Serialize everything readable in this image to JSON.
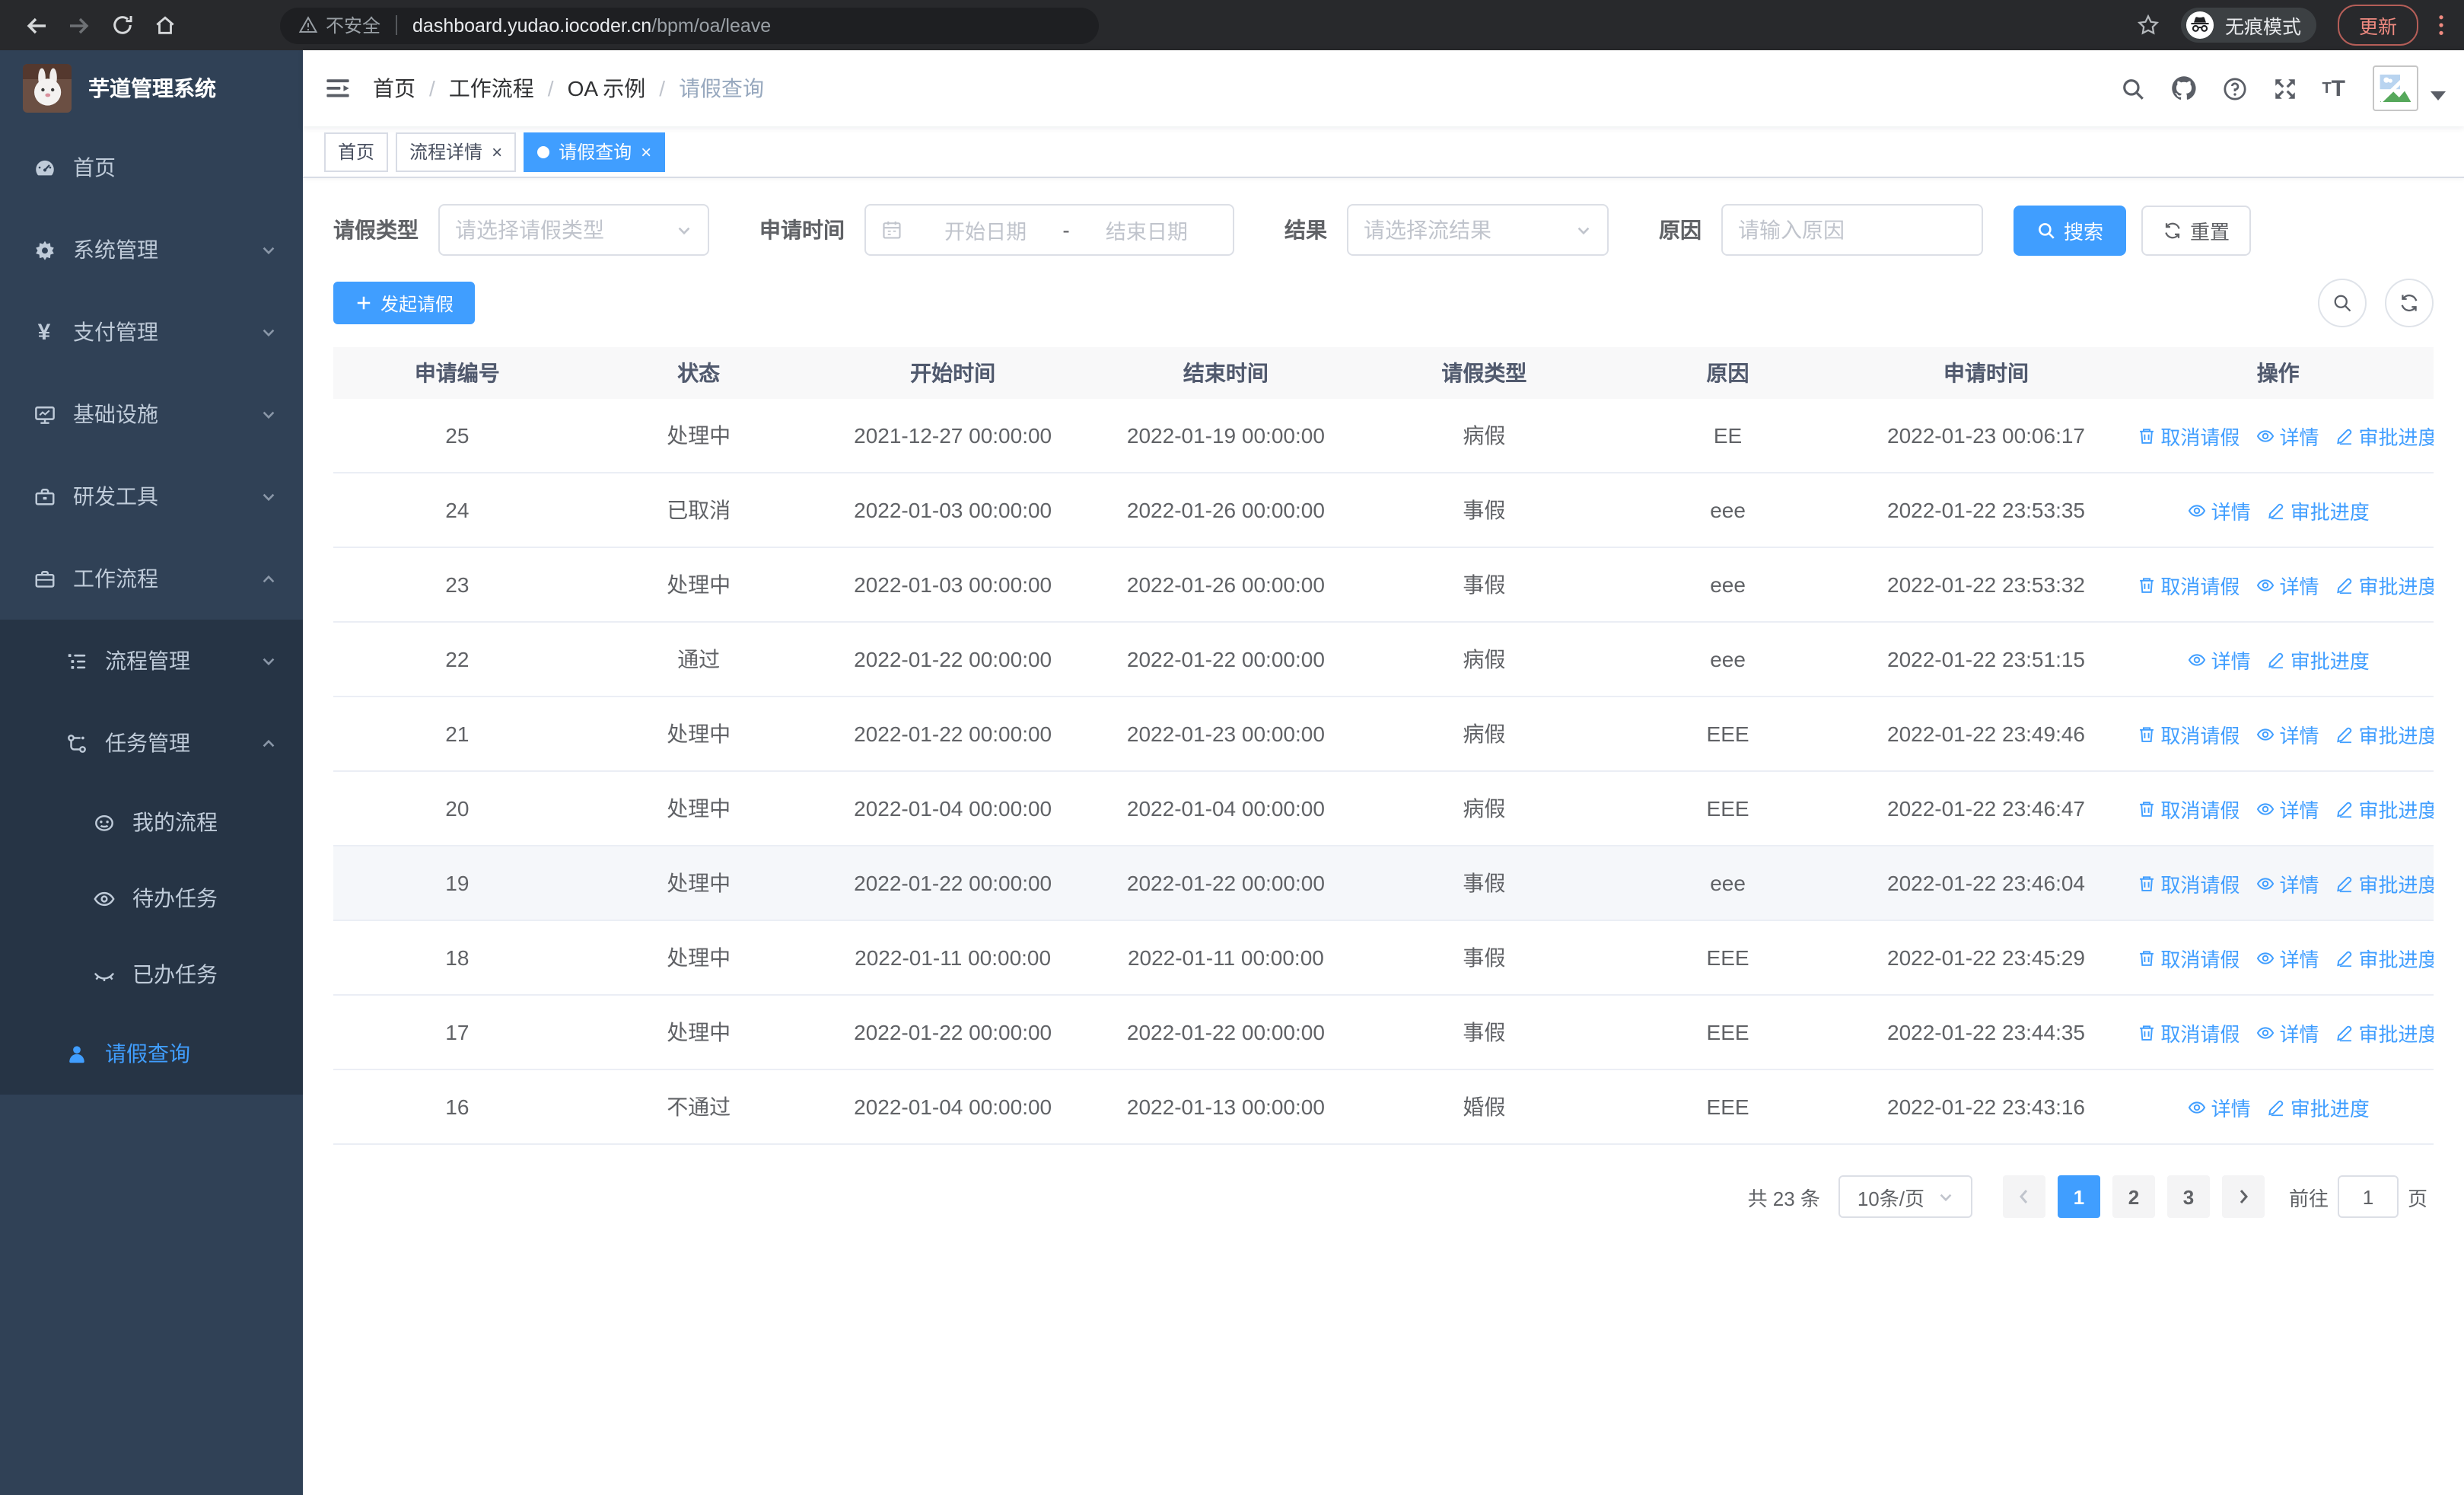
{
  "browser": {
    "security_label": "不安全",
    "url_domain": "dashboard.yudao.iocoder.cn",
    "url_path": "/bpm/oa/leave",
    "incognito_label": "无痕模式",
    "update_label": "更新"
  },
  "sidebar": {
    "title": "芋道管理系统",
    "items": [
      {
        "key": "home",
        "label": "首页",
        "icon": "dashboard",
        "level": 1
      },
      {
        "key": "system",
        "label": "系统管理",
        "icon": "gear",
        "level": 1,
        "chevron": "down"
      },
      {
        "key": "payment",
        "label": "支付管理",
        "icon": "yen",
        "level": 1,
        "chevron": "down"
      },
      {
        "key": "infra",
        "label": "基础设施",
        "icon": "monitor",
        "level": 1,
        "chevron": "down"
      },
      {
        "key": "devtools",
        "label": "研发工具",
        "icon": "toolbox",
        "level": 1,
        "chevron": "down"
      },
      {
        "key": "workflow",
        "label": "工作流程",
        "icon": "briefcase",
        "level": 1,
        "chevron": "up"
      },
      {
        "key": "process-mgmt",
        "label": "流程管理",
        "icon": "listicon",
        "level": 2,
        "chevron": "down",
        "nested": true
      },
      {
        "key": "task-mgmt",
        "label": "任务管理",
        "icon": "flow",
        "level": 2,
        "chevron": "up",
        "nested": true
      },
      {
        "key": "my-process",
        "label": "我的流程",
        "icon": "face",
        "level": 3,
        "nested": true
      },
      {
        "key": "todo-tasks",
        "label": "待办任务",
        "icon": "eye",
        "level": 3,
        "nested": true
      },
      {
        "key": "done-tasks",
        "label": "已办任务",
        "icon": "eyeclosed",
        "level": 3,
        "nested": true
      },
      {
        "key": "leave-query",
        "label": "请假查询",
        "icon": "user",
        "level": 2,
        "nested": true,
        "active": true
      }
    ]
  },
  "navbar": {
    "breadcrumb": [
      "首页",
      "工作流程",
      "OA 示例",
      "请假查询"
    ]
  },
  "tabs": [
    {
      "key": "home",
      "label": "首页",
      "closable": false,
      "active": false
    },
    {
      "key": "process-detail",
      "label": "流程详情",
      "closable": true,
      "active": false
    },
    {
      "key": "leave-query",
      "label": "请假查询",
      "closable": true,
      "active": true
    }
  ],
  "filters": {
    "leave_type_label": "请假类型",
    "leave_type_placeholder": "请选择请假类型",
    "apply_time_label": "申请时间",
    "date_start_placeholder": "开始日期",
    "date_separator": "-",
    "date_end_placeholder": "结束日期",
    "result_label": "结果",
    "result_placeholder": "请选择流结果",
    "reason_label": "原因",
    "reason_placeholder": "请输入原因",
    "search_label": "搜索",
    "reset_label": "重置"
  },
  "toolbar": {
    "create_label": "发起请假"
  },
  "table": {
    "columns": [
      "申请编号",
      "状态",
      "开始时间",
      "结束时间",
      "请假类型",
      "原因",
      "申请时间",
      "操作"
    ],
    "action_labels": {
      "cancel": "取消请假",
      "detail": "详情",
      "progress": "审批进度"
    },
    "rows": [
      {
        "id": "25",
        "status": "处理中",
        "start": "2021-12-27 00:00:00",
        "end": "2022-01-19 00:00:00",
        "type": "病假",
        "reason": "EE",
        "apply_time": "2022-01-23 00:06:17",
        "actions": [
          "cancel",
          "detail",
          "progress"
        ],
        "highlighted": false
      },
      {
        "id": "24",
        "status": "已取消",
        "start": "2022-01-03 00:00:00",
        "end": "2022-01-26 00:00:00",
        "type": "事假",
        "reason": "eee",
        "apply_time": "2022-01-22 23:53:35",
        "actions": [
          "detail",
          "progress"
        ],
        "highlighted": false
      },
      {
        "id": "23",
        "status": "处理中",
        "start": "2022-01-03 00:00:00",
        "end": "2022-01-26 00:00:00",
        "type": "事假",
        "reason": "eee",
        "apply_time": "2022-01-22 23:53:32",
        "actions": [
          "cancel",
          "detail",
          "progress"
        ],
        "highlighted": false
      },
      {
        "id": "22",
        "status": "通过",
        "start": "2022-01-22 00:00:00",
        "end": "2022-01-22 00:00:00",
        "type": "病假",
        "reason": "eee",
        "apply_time": "2022-01-22 23:51:15",
        "actions": [
          "detail",
          "progress"
        ],
        "highlighted": false
      },
      {
        "id": "21",
        "status": "处理中",
        "start": "2022-01-22 00:00:00",
        "end": "2022-01-23 00:00:00",
        "type": "病假",
        "reason": "EEE",
        "apply_time": "2022-01-22 23:49:46",
        "actions": [
          "cancel",
          "detail",
          "progress"
        ],
        "highlighted": false
      },
      {
        "id": "20",
        "status": "处理中",
        "start": "2022-01-04 00:00:00",
        "end": "2022-01-04 00:00:00",
        "type": "病假",
        "reason": "EEE",
        "apply_time": "2022-01-22 23:46:47",
        "actions": [
          "cancel",
          "detail",
          "progress"
        ],
        "highlighted": false
      },
      {
        "id": "19",
        "status": "处理中",
        "start": "2022-01-22 00:00:00",
        "end": "2022-01-22 00:00:00",
        "type": "事假",
        "reason": "eee",
        "apply_time": "2022-01-22 23:46:04",
        "actions": [
          "cancel",
          "detail",
          "progress"
        ],
        "highlighted": true
      },
      {
        "id": "18",
        "status": "处理中",
        "start": "2022-01-11 00:00:00",
        "end": "2022-01-11 00:00:00",
        "type": "事假",
        "reason": "EEE",
        "apply_time": "2022-01-22 23:45:29",
        "actions": [
          "cancel",
          "detail",
          "progress"
        ],
        "highlighted": false
      },
      {
        "id": "17",
        "status": "处理中",
        "start": "2022-01-22 00:00:00",
        "end": "2022-01-22 00:00:00",
        "type": "事假",
        "reason": "EEE",
        "apply_time": "2022-01-22 23:44:35",
        "actions": [
          "cancel",
          "detail",
          "progress"
        ],
        "highlighted": false
      },
      {
        "id": "16",
        "status": "不通过",
        "start": "2022-01-04 00:00:00",
        "end": "2022-01-13 00:00:00",
        "type": "婚假",
        "reason": "EEE",
        "apply_time": "2022-01-22 23:43:16",
        "actions": [
          "detail",
          "progress"
        ],
        "highlighted": false
      }
    ]
  },
  "pagination": {
    "total_label": "共 23 条",
    "page_size": "10条/页",
    "pages": [
      "1",
      "2",
      "3"
    ],
    "active_page": "1",
    "goto_label": "前往",
    "goto_value": "1",
    "page_unit": "页"
  },
  "colors": {
    "accent": "#409eff",
    "sidebar_bg": "#304156",
    "sidebar_submenu_bg": "#263445",
    "update_accent": "#ef8a80"
  }
}
